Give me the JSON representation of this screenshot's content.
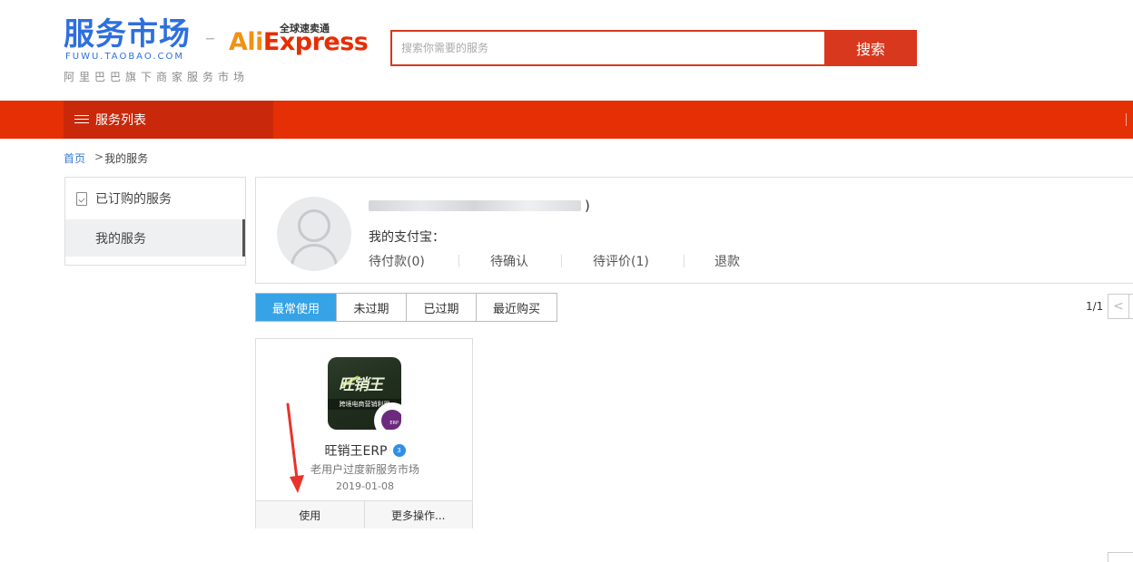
{
  "header": {
    "logo_main": "服务市场",
    "logo_sub": "FUWU.TAOBAO.COM",
    "logo_tagline": "阿里巴巴旗下商家服务市场",
    "partner_tag": "全球速卖通",
    "partner_ali": "Ali",
    "partner_express": "Express",
    "search_placeholder": "搜索你需要的服务",
    "search_button": "搜索"
  },
  "nav": {
    "service_list": "服务列表"
  },
  "breadcrumb": {
    "home": "首页",
    "separator": ">",
    "current": "我的服务"
  },
  "sidebar": {
    "heading": "已订购的服务",
    "items": [
      {
        "label": "我的服务",
        "active": true
      }
    ]
  },
  "profile": {
    "username_suffix": ")",
    "alipay_label": "我的支付宝：",
    "stats": [
      {
        "label": "待付款(0)"
      },
      {
        "label": "待确认"
      },
      {
        "label": "待评价(1)"
      },
      {
        "label": "退款"
      }
    ]
  },
  "tabs": [
    {
      "label": "最常使用",
      "active": true
    },
    {
      "label": "未过期",
      "active": false
    },
    {
      "label": "已过期",
      "active": false
    },
    {
      "label": "最近购买",
      "active": false
    }
  ],
  "pager": {
    "text": "1/1",
    "prev": "<"
  },
  "app_card": {
    "icon_title": "旺销王",
    "icon_subtitle": "跨境电商营销利器",
    "icon_badge": "ERP",
    "name": "旺销王ERP",
    "badge": "3",
    "description": "老用户过度新服务市场",
    "date": "2019-01-08",
    "use_button": "使用",
    "more_button": "更多操作..."
  },
  "colors": {
    "brand_red": "#e52f05",
    "tab_active": "#35a3e6",
    "logo_blue": "#2e6fdf"
  }
}
